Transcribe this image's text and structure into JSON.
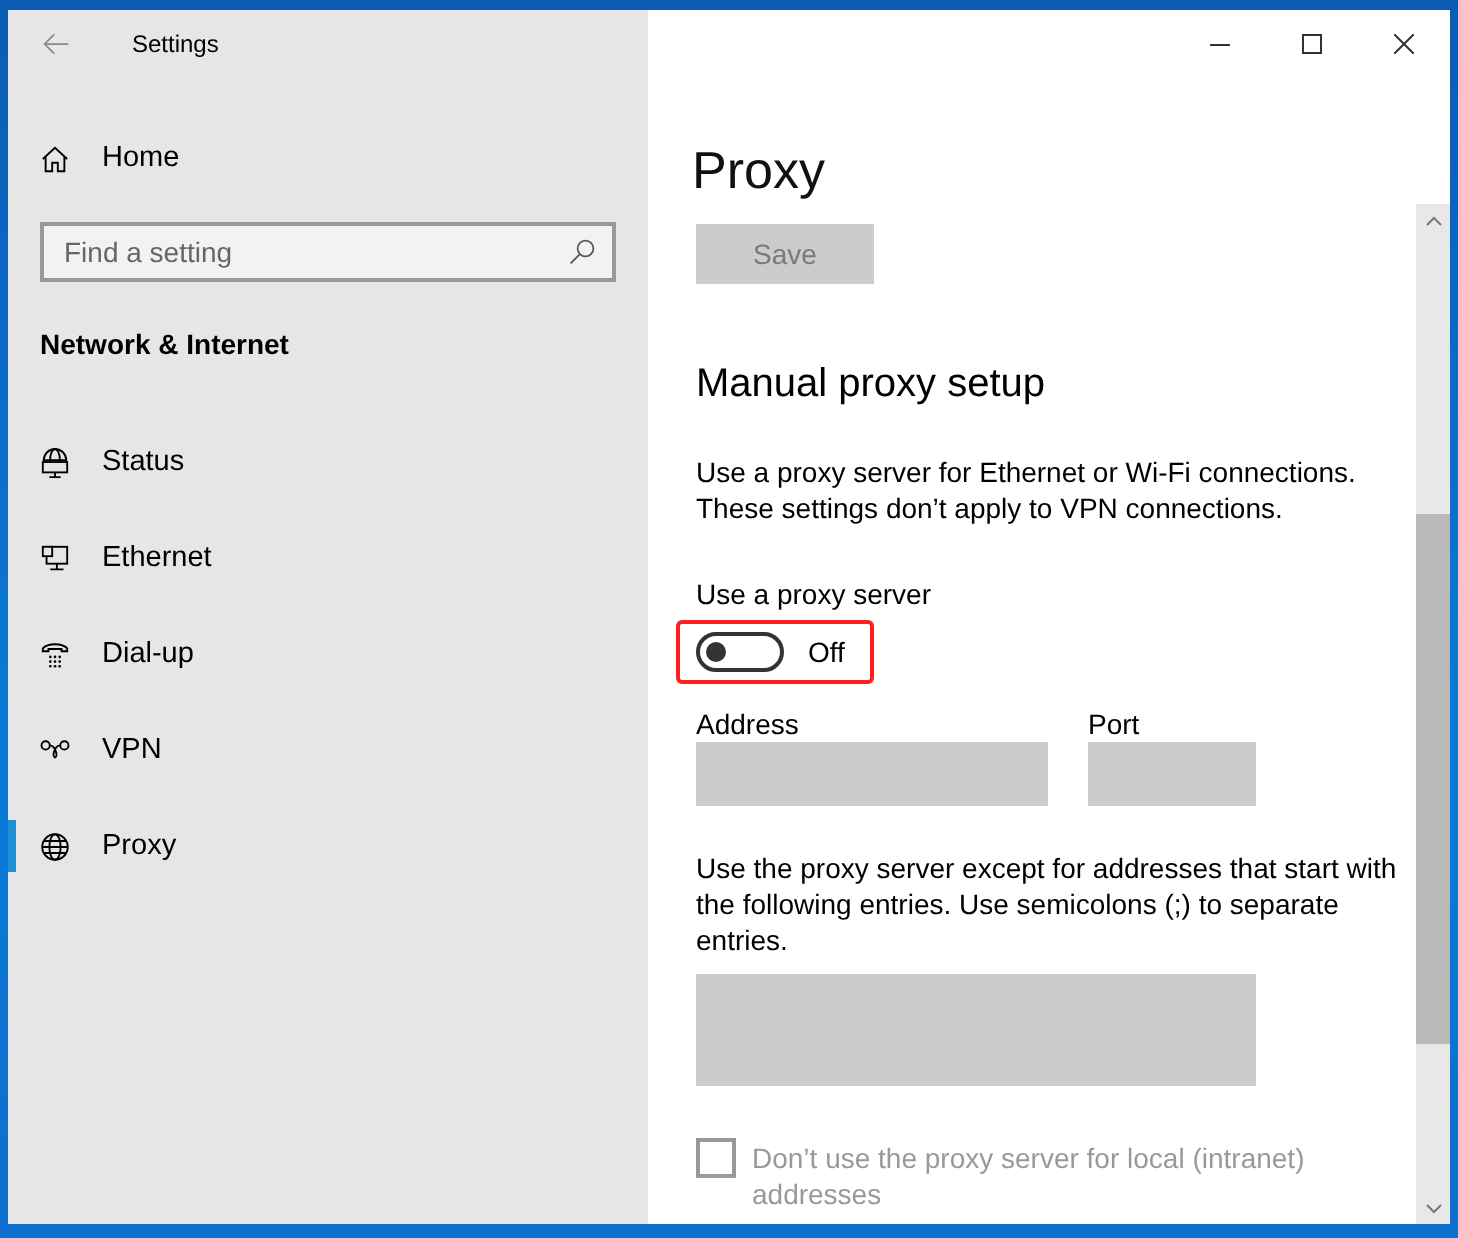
{
  "window": {
    "title": "Settings"
  },
  "sidebar": {
    "home": "Home",
    "search": {
      "placeholder": "Find a setting"
    },
    "section_title": "Network & Internet",
    "items": [
      {
        "label": "Status",
        "selected": false
      },
      {
        "label": "Ethernet",
        "selected": false
      },
      {
        "label": "Dial-up",
        "selected": false
      },
      {
        "label": "VPN",
        "selected": false
      },
      {
        "label": "Proxy",
        "selected": true
      }
    ]
  },
  "page": {
    "title": "Proxy",
    "save_button": {
      "label": "Save",
      "disabled": true
    },
    "section_title": "Manual proxy setup",
    "description": "Use a proxy server for Ethernet or Wi-Fi connections. These settings don’t apply to VPN connections.",
    "proxy_switch": {
      "label": "Use a proxy server",
      "on": false,
      "state_label": "Off",
      "highlighted": true
    },
    "address": {
      "label": "Address",
      "disabled": true
    },
    "port": {
      "label": "Port",
      "disabled": true
    },
    "exceptions": {
      "description": "Use the proxy server except for addresses that start with the following entries. Use semicolons (;) to separate entries.",
      "disabled": true
    },
    "local_bypass": {
      "label": "Don’t use the proxy server for local (intranet) addresses",
      "checked": false,
      "disabled": true
    }
  }
}
